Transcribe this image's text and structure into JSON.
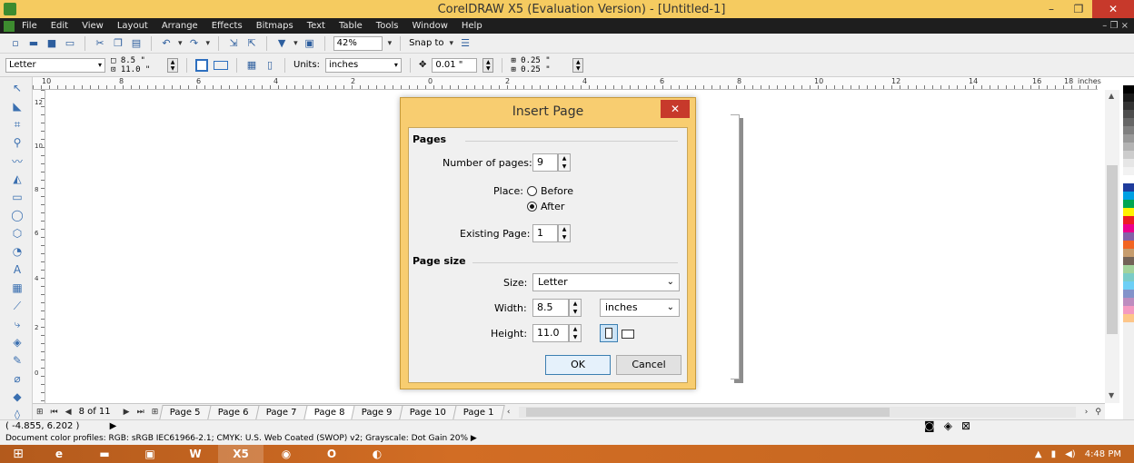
{
  "window": {
    "title": "CorelDRAW X5 (Evaluation Version) - [Untitled-1]",
    "minimize": "–",
    "restore": "❐",
    "close": "✕"
  },
  "menu": {
    "items": [
      "File",
      "Edit",
      "View",
      "Layout",
      "Arrange",
      "Effects",
      "Bitmaps",
      "Text",
      "Table",
      "Tools",
      "Window",
      "Help"
    ],
    "right_controls": "– ❐ ×"
  },
  "toolbar": {
    "zoom": "42%",
    "snap_label": "Snap to"
  },
  "propertybar": {
    "paper_size": "Letter",
    "width": "8.5 \"",
    "height": "11.0 \"",
    "units_label": "Units:",
    "units_value": "inches",
    "nudge": "0.01 \"",
    "dup_x": "0.25 \"",
    "dup_y": "0.25 \""
  },
  "ruler": {
    "h_labels": [
      "10",
      "8",
      "6",
      "4",
      "2",
      "0",
      "2",
      "4",
      "6",
      "8",
      "10",
      "12",
      "14",
      "16",
      "18"
    ],
    "unit": "inches",
    "v_labels": [
      "12",
      "10",
      "8",
      "6",
      "4",
      "2",
      "0"
    ]
  },
  "pagebar": {
    "count": "8 of 11",
    "tabs": [
      "Page 5",
      "Page 6",
      "Page 7",
      "Page 8",
      "Page 9",
      "Page 10",
      "Page 1"
    ],
    "active_index": 3
  },
  "status": {
    "coords": "( -4.855, 6.202 )",
    "profiles": "Document color profiles: RGB: sRGB IEC61966-2.1; CMYK: U.S. Web Coated (SWOP) v2; Grayscale: Dot Gain 20% ▶"
  },
  "taskbar": {
    "time": "4:48 PM"
  },
  "dialog": {
    "title": "Insert Page",
    "close": "✕",
    "pages_section": "Pages",
    "num_pages_label": "Number of pages:",
    "num_pages_value": "9",
    "place_label": "Place:",
    "before_label": "Before",
    "after_label": "After",
    "place_selected": "after",
    "existing_label": "Existing Page:",
    "existing_value": "1",
    "pagesize_section": "Page size",
    "size_label": "Size:",
    "size_value": "Letter",
    "width_label": "Width:",
    "width_value": "8.5",
    "units_value": "inches",
    "height_label": "Height:",
    "height_value": "11.0",
    "ok_label": "OK",
    "cancel_label": "Cancel"
  },
  "palette": [
    "#ffffff",
    "#000000",
    "#1a1a1a",
    "#333333",
    "#4d4d4d",
    "#666666",
    "#808080",
    "#999999",
    "#b3b3b3",
    "#cccccc",
    "#e6e6e6",
    "#f2f2f2",
    "#ffffff",
    "#1f3c9c",
    "#00a0e3",
    "#00a651",
    "#fff200",
    "#ed1c24",
    "#ec008c",
    "#8560a8",
    "#f26522",
    "#c69c6d",
    "#736357",
    "#a3d39c",
    "#7accc8",
    "#6dcff6",
    "#8393ca",
    "#bd8cbf",
    "#f49ac1",
    "#fdc689"
  ]
}
